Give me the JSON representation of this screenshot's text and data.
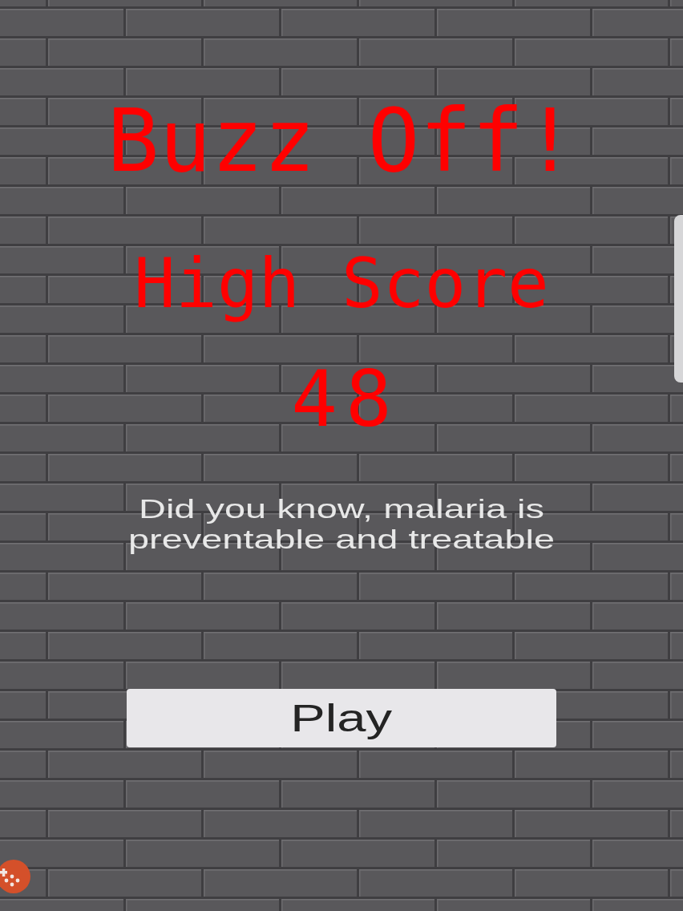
{
  "title": "Buzz Off!",
  "high_score": {
    "label": "High Score",
    "value": "48"
  },
  "fact": "Did you know, malaria is preventable and treatable",
  "play_button": {
    "label": "Play"
  }
}
